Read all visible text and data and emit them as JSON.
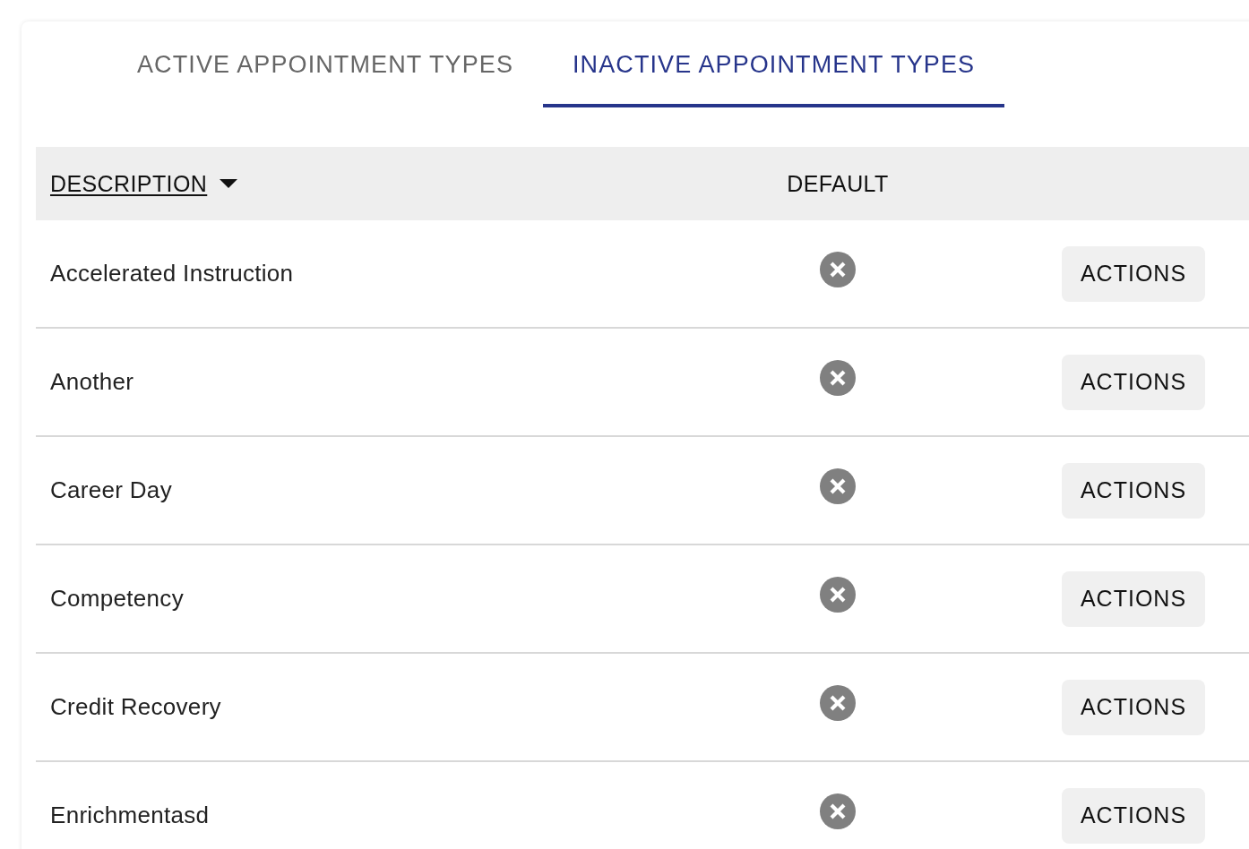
{
  "tabs": [
    {
      "label": "ACTIVE APPOINTMENT TYPES",
      "selected": false
    },
    {
      "label": "INACTIVE APPOINTMENT TYPES",
      "selected": true
    }
  ],
  "table": {
    "columns": [
      {
        "label": "DESCRIPTION",
        "sorted": true
      },
      {
        "label": "DEFAULT",
        "sorted": false
      }
    ],
    "rows": [
      {
        "description": "Accelerated Instruction",
        "default": false,
        "action": "ACTIONS"
      },
      {
        "description": "Another",
        "default": false,
        "action": "ACTIONS"
      },
      {
        "description": "Career Day",
        "default": false,
        "action": "ACTIONS"
      },
      {
        "description": "Competency",
        "default": false,
        "action": "ACTIONS"
      },
      {
        "description": "Credit Recovery",
        "default": false,
        "action": "ACTIONS"
      },
      {
        "description": "Enrichmentasd",
        "default": false,
        "action": "ACTIONS"
      }
    ]
  }
}
